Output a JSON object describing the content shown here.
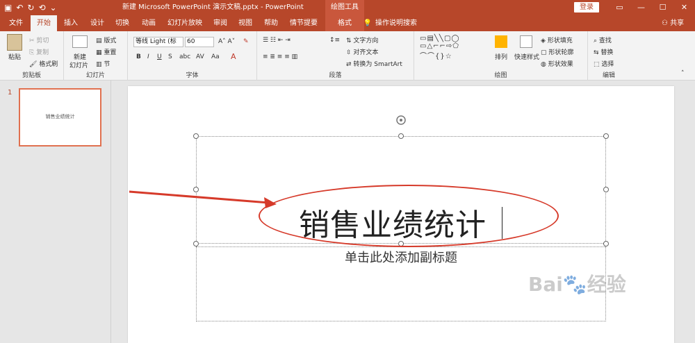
{
  "window": {
    "title": "新建 Microsoft PowerPoint 演示文稿.pptx  -  PowerPoint",
    "tools_header": "绘图工具",
    "login": "登录",
    "controls": [
      "▭",
      "—",
      "☐",
      "✕"
    ]
  },
  "qat": [
    "▣",
    "↶",
    "↻",
    "⟲",
    "⌄"
  ],
  "tabs": [
    {
      "label": "文件"
    },
    {
      "label": "开始"
    },
    {
      "label": "插入"
    },
    {
      "label": "设计"
    },
    {
      "label": "切换"
    },
    {
      "label": "动画"
    },
    {
      "label": "幻灯片放映"
    },
    {
      "label": "审阅"
    },
    {
      "label": "视图"
    },
    {
      "label": "帮助"
    },
    {
      "label": "情节提要"
    },
    {
      "label": "格式"
    }
  ],
  "tell_me": "操作说明搜索",
  "share": "共享",
  "ribbon": {
    "clipboard": {
      "paste": "粘贴",
      "cut": "剪切",
      "copy": "复制",
      "format_painter": "格式刷",
      "label": "剪贴板"
    },
    "slides": {
      "new_slide": "新建",
      "new_slide_2": "幻灯片",
      "layout": "版式",
      "reset": "重置",
      "section": "节",
      "label": "幻灯片"
    },
    "font": {
      "font_name": "等线 Light (标",
      "font_size": "60",
      "label": "字体"
    },
    "paragraph": {
      "text_direction": "文字方向",
      "align_text": "对齐文本",
      "smartart": "转换为 SmartArt",
      "label": "段落"
    },
    "drawing": {
      "arrange": "排列",
      "quick_styles": "快速样式",
      "shape_fill": "形状填充",
      "shape_outline": "形状轮廓",
      "shape_effects": "形状效果",
      "label": "绘图"
    },
    "editing": {
      "find": "查找",
      "replace": "替换",
      "select": "选择",
      "label": "编辑"
    }
  },
  "thumbnail": {
    "number": "1",
    "title": "销售业绩统计"
  },
  "slide": {
    "title": "销售业绩统计",
    "subtitle": "单击此处添加副标题"
  },
  "colors": {
    "accent": "#b7472a",
    "highlight": "#d63a2a"
  }
}
